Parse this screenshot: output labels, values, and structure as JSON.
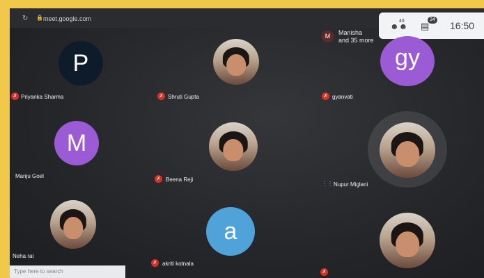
{
  "browser": {
    "url": "meet.google.com",
    "reload_icon": "reload-icon"
  },
  "meeting": {
    "clock": "16:50",
    "people_count": "46",
    "chat_badge": "34",
    "presenter_initial": "M",
    "presenter_line1": "Manisha",
    "presenter_line2": "and 35 more"
  },
  "participants": [
    {
      "name": "Priyanka Sharma",
      "avatar": "P"
    },
    {
      "name": "Shruti Gupta"
    },
    {
      "name": "gyanvati",
      "avatar": "gy"
    },
    {
      "name": "Manju Goel",
      "avatar": "M"
    },
    {
      "name": "Beena Reji"
    },
    {
      "name": "Nupur Miglani"
    },
    {
      "name": "Neha rai"
    },
    {
      "name": "akriti kotnala",
      "avatar": "a"
    },
    {
      "name": ""
    }
  ],
  "chat_input": {
    "placeholder": "Type here to search"
  },
  "colors": {
    "background_frame": "#f2c84b",
    "meet_dark": "#25272a",
    "mic_off": "#d93025",
    "avatar_purple": "#9a5bd4",
    "avatar_navy": "#0d1b2a",
    "avatar_blue": "#4fa3d9"
  }
}
